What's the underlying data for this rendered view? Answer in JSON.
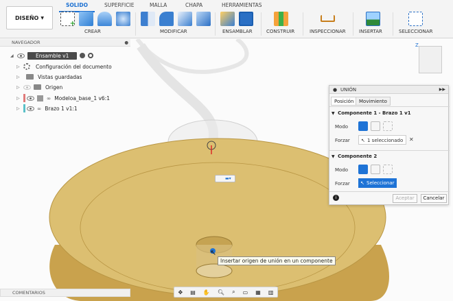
{
  "toolbar": {
    "design_label": "DISEÑO",
    "tabs": [
      "SOLIDO",
      "SUPERFICIE",
      "MALLA",
      "CHAPA",
      "HERRAMIENTAS"
    ],
    "active_tab": "SOLIDO",
    "groups": [
      "CREAR",
      "MODIFICAR",
      "ENSAMBLAR",
      "CONSTRUIR",
      "INSPECCIONAR",
      "INSERTAR",
      "SELECCIONAR"
    ],
    "accent": "#1a6fd1"
  },
  "navigator": {
    "title": "NAVEGADOR",
    "assembly_label": "Ensamble v1",
    "items": [
      {
        "label": "Configuración del documento",
        "icon": "gear-icon"
      },
      {
        "label": "Vistas guardadas",
        "icon": "folder-icon"
      },
      {
        "label": "Origen",
        "icon": "folder-icon"
      },
      {
        "label": "Modeloa_base_1 v6:1",
        "icon": "link-icon"
      },
      {
        "label": "Brazo 1 v1:1",
        "icon": "link-icon"
      }
    ]
  },
  "union": {
    "title": "UNIÓN",
    "tabs": [
      "Posición",
      "Movimiento"
    ],
    "component1": {
      "title": "Componente 1 - Brazo 1 v1",
      "mode_label": "Modo",
      "force_label": "Forzar",
      "selection": "1 seleccionado"
    },
    "component2": {
      "title": "Componente 2",
      "mode_label": "Modo",
      "force_label": "Forzar",
      "selection": "Seleccionar"
    },
    "accept_label": "Aceptar",
    "cancel_label": "Cancelar"
  },
  "tooltip": "Insertar origen de unión en un componente",
  "comments_label": "COMENTARIOS",
  "colors": {
    "model_top": "#dcbf71",
    "model_side": "#c9a24d",
    "selection_blue": "#1e73d6"
  }
}
